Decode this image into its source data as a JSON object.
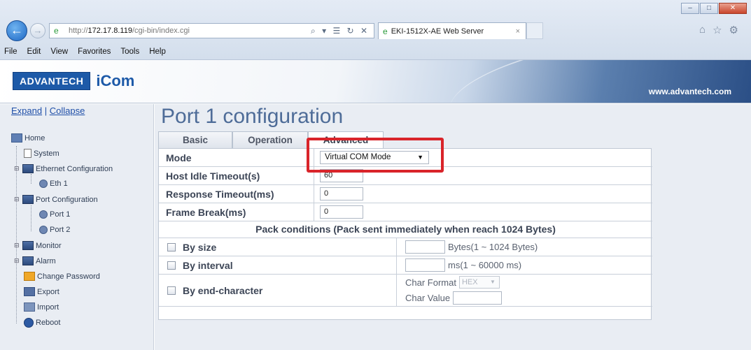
{
  "browser": {
    "url_prefix": "http://",
    "url_host": "172.17.8.119",
    "url_path": "/cgi-bin/index.cgi",
    "url_tools": "⌕ ▾ ☰ ↻ ✕",
    "tab_title": "EKI-1512X-AE Web Server",
    "tab_close": "×",
    "menu": [
      "File",
      "Edit",
      "View",
      "Favorites",
      "Tools",
      "Help"
    ],
    "window_buttons": {
      "minimize": "–",
      "maximize": "□",
      "close": "✕"
    },
    "back_glyph": "←",
    "forward_glyph": "→",
    "favicon": "e",
    "right_icons": {
      "home": "⌂",
      "favorites": "☆",
      "settings": "⚙"
    },
    "accent_close": "#c9462c"
  },
  "banner": {
    "brand": "ADVANTECH",
    "product": "iCom",
    "site": "www.advantech.com",
    "brand_color": "#1d5aa8"
  },
  "nav": {
    "expand": "Expand",
    "separator": "|",
    "collapse": "Collapse",
    "expander": "⊟",
    "items": [
      {
        "label": "Home"
      },
      {
        "label": "System"
      },
      {
        "label": "Ethernet Configuration"
      },
      {
        "label": "Eth 1"
      },
      {
        "label": "Port Configuration"
      },
      {
        "label": "Port 1"
      },
      {
        "label": "Port 2"
      },
      {
        "label": "Monitor"
      },
      {
        "label": "Alarm"
      },
      {
        "label": "Change Password"
      },
      {
        "label": "Export"
      },
      {
        "label": "Import"
      },
      {
        "label": "Reboot"
      }
    ]
  },
  "main": {
    "title": "Port 1 configuration",
    "tabs": [
      {
        "label": "Basic"
      },
      {
        "label": "Operation"
      },
      {
        "label": "Advanced"
      }
    ],
    "mode": {
      "label": "Mode",
      "value": "Virtual COM Mode",
      "arrow": "▼"
    },
    "host_idle": {
      "label": "Host Idle Timeout(s)",
      "value": "60"
    },
    "response_timeout": {
      "label": "Response Timeout(ms)",
      "value": "0"
    },
    "frame_break": {
      "label": "Frame Break(ms)",
      "value": "0"
    },
    "pack_title": "Pack conditions (Pack sent immediately when reach 1024 Bytes)",
    "by_size": {
      "label": "By size",
      "value": "",
      "unit": "Bytes(1 ~ 1024 Bytes)"
    },
    "by_interval": {
      "label": "By interval",
      "value": "",
      "unit": "ms(1 ~ 60000 ms)"
    },
    "by_end_char": {
      "label": "By end-character",
      "char_format_label": "Char Format",
      "char_format_value": "HEX",
      "char_value_label": "Char Value",
      "char_value": ""
    },
    "highlight_color": "#d9242a"
  }
}
